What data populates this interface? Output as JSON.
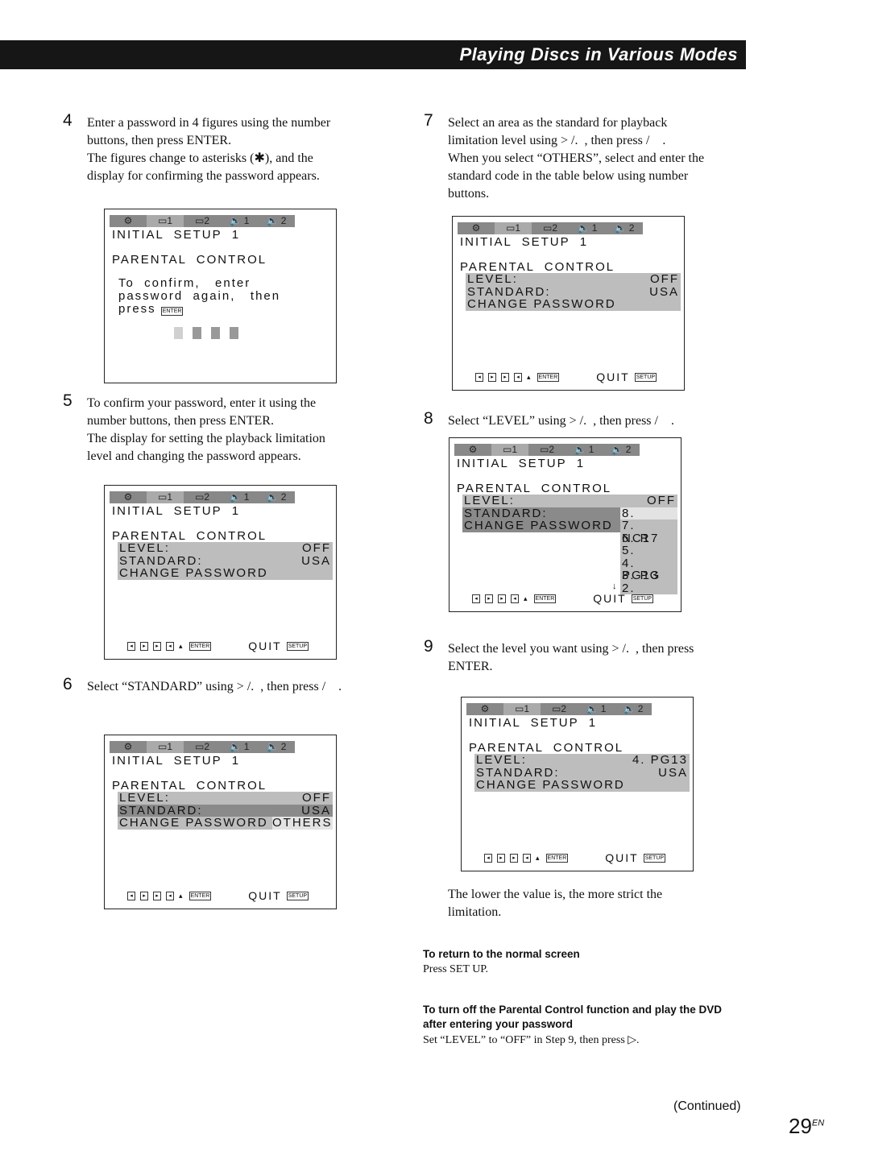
{
  "header": {
    "title": "Playing Discs in Various Modes"
  },
  "steps": [
    {
      "num": "4",
      "text": "Enter a password in 4 figures using the number\nbuttons, then press ENTER.\nThe figures change to asterisks (✱), and the\ndisplay for confirming the password appears."
    },
    {
      "num": "5",
      "text": "To confirm your password, enter it using the\nnumber buttons, then press ENTER.\nThe display for setting the playback limitation\nlevel and changing the password appears."
    },
    {
      "num": "6",
      "text": "Select “STANDARD” using > /.  , then press /    ."
    },
    {
      "num": "7",
      "text": "Select an area as the standard for playback\nlimitation level using > /.  , then press /    .\nWhen you select “OTHERS”, select and enter the\nstandard code in the table below using number\nbuttons."
    },
    {
      "num": "8",
      "text": "Select “LEVEL” using > /.  , then press /    ."
    },
    {
      "num": "9",
      "text": "Select the level you want using > /.  , then press\nENTER."
    }
  ],
  "note": "The lower the value is, the more strict the\nlimitation.",
  "osd": {
    "tabs": [
      "⚙",
      "▭1",
      "▭2",
      "🔈 1",
      "🔈 2"
    ],
    "title": "INITIAL  SETUP  1",
    "section": "PARENTAL  CONTROL",
    "confirm": "To  confirm,   enter\npassword  again,   then\npress",
    "enter_key": "ENTER",
    "setup_key": "SETUP",
    "quit": "QUIT",
    "level_label": "LEVEL:",
    "standard_label": "STANDARD:",
    "change_password": "CHANGE  PASSWORD",
    "off": "OFF",
    "usa": "USA",
    "others": "OTHERS",
    "level_value_step9": "4.  PG13",
    "level_list": [
      "8.",
      "7.  NC17",
      "6.        R",
      "5.",
      "4.  PG13",
      "3.      PG",
      "2."
    ]
  },
  "subsections": [
    {
      "heading": "To return to the normal screen",
      "text": "Press SET UP."
    },
    {
      "heading": "To turn off the Parental Control function and play the DVD\nafter entering your password",
      "text": "Set “LEVEL” to “OFF” in Step 9, then press ▷."
    }
  ],
  "footer": {
    "continued": "(Continued)",
    "page": "29",
    "page_suffix": "EN"
  }
}
